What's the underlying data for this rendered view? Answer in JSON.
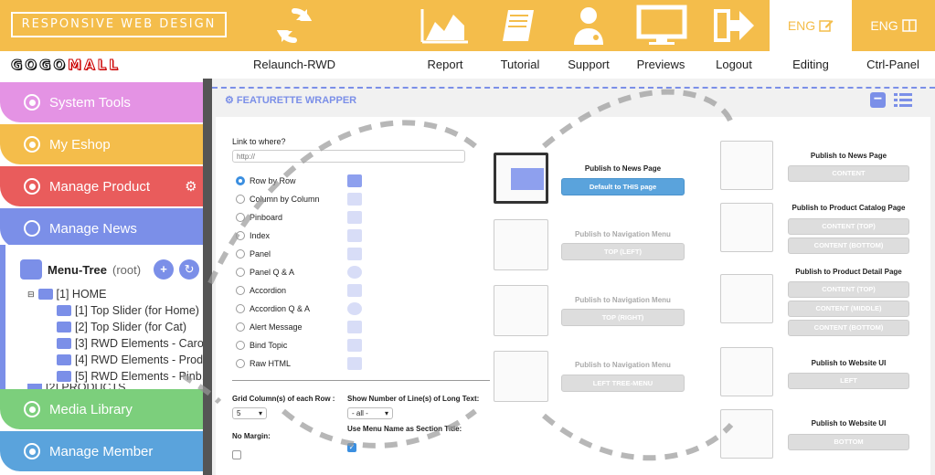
{
  "header": {
    "site_label": "RESPONSIVE WEB DESIGN",
    "brand": "GOGOMALL",
    "nav": [
      {
        "label": "Relaunch-RWD",
        "icon": "refresh-icon"
      },
      {
        "label": "Report",
        "icon": "area-chart-icon"
      },
      {
        "label": "Tutorial",
        "icon": "book-icon"
      },
      {
        "label": "Support",
        "icon": "doctor-icon"
      },
      {
        "label": "Previews",
        "icon": "monitor-icon"
      },
      {
        "label": "Logout",
        "icon": "logout-arrow-icon"
      },
      {
        "label": "Editing",
        "icon": "edit-icon"
      },
      {
        "label": "Ctrl-Panel",
        "icon": "panel-icon"
      }
    ],
    "eng_editing": "ENG",
    "eng_ctrl": "ENG"
  },
  "sidebar": {
    "items": [
      {
        "label": "System Tools",
        "color": "#e493e4"
      },
      {
        "label": "My Eshop",
        "color": "#f4bd4b"
      },
      {
        "label": "Manage Product",
        "color": "#e95c5c"
      },
      {
        "label": "Manage News",
        "color": "#7b8fe8"
      },
      {
        "label": "Media Library",
        "color": "#7ccf7c"
      },
      {
        "label": "Manage Member",
        "color": "#5aa3dc"
      }
    ],
    "tree": {
      "title": "Menu-Tree",
      "suffix": "(root)",
      "rows": [
        "[1]  HOME",
        "[1]  Top Slider (for Home)",
        "[2]  Top Slider (for Cat)",
        "[3]  RWD Elements - Caro...",
        "[4]  RWD Elements - Prod...",
        "[5]  RWD Elements - Pinb...",
        "[2]  PRODUCTS"
      ]
    }
  },
  "main": {
    "wrapper_title": "FEATURETTE WRAPPER",
    "link_label": "Link to where?",
    "link_placeholder": "http://",
    "options": [
      "Row by Row",
      "Column by Column",
      "Pinboard",
      "Index",
      "Panel",
      "Panel Q & A",
      "Accordion",
      "Accordion Q & A",
      "Alert Message",
      "Bind Topic",
      "Raw HTML"
    ],
    "selected_option": "Row by Row",
    "grid_label": "Grid Column(s) of each Row :",
    "grid_value": "5",
    "lines_label": "Show Number of Line(s) of Long Text:",
    "lines_value": "- all -",
    "menu_name_label": "Use Menu Name as Section Title:",
    "no_margin_label": "No Margin:",
    "publish_mid": [
      {
        "title": "Publish to News Page",
        "button": "Default to THIS page",
        "active": true
      },
      {
        "title": "Publish to Navigation Menu",
        "button": "TOP (LEFT)"
      },
      {
        "title": "Publish to Navigation Menu",
        "button": "TOP (RIGHT)"
      },
      {
        "title": "Publish to Navigation Menu",
        "button": "LEFT TREE-MENU"
      }
    ],
    "publish_right": [
      {
        "title": "Publish to News Page",
        "buttons": [
          "CONTENT"
        ]
      },
      {
        "title": "Publish to Product Catalog Page",
        "buttons": [
          "CONTENT (TOP)",
          "CONTENT (BOTTOM)"
        ]
      },
      {
        "title": "Publish to Product Detail Page",
        "buttons": [
          "CONTENT (TOP)",
          "CONTENT (MIDDLE)",
          "CONTENT (BOTTOM)"
        ]
      },
      {
        "title": "Publish to Website UI",
        "buttons": [
          "LEFT"
        ]
      },
      {
        "title": "Publish to Website UI",
        "buttons": [
          "BOTTOM"
        ]
      }
    ]
  }
}
